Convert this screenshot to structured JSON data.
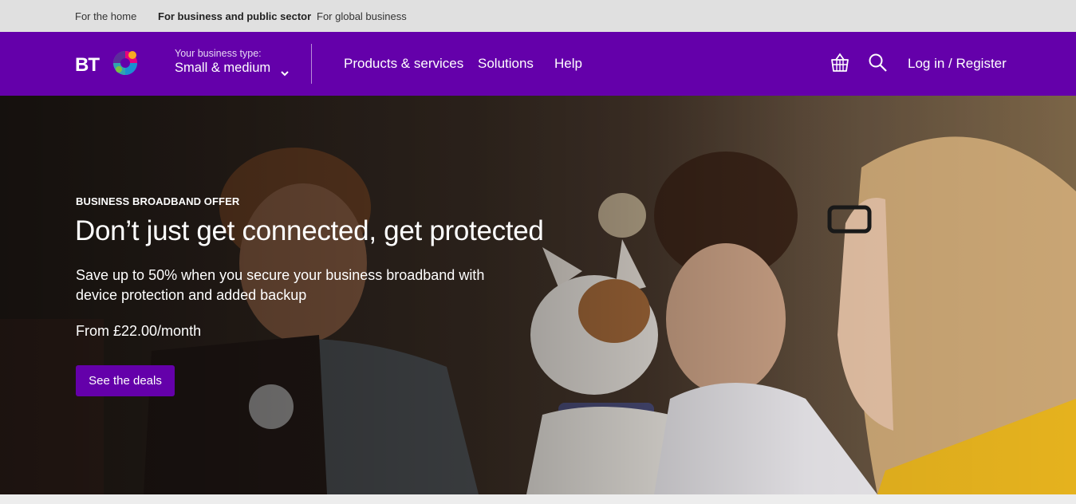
{
  "topbar": {
    "links": [
      "For the home",
      "For business and public sector",
      "For global business"
    ],
    "active_index": 1
  },
  "nav": {
    "logo_text": "BT",
    "business_type_label": "Your business type:",
    "business_type_value": "Small & medium",
    "links": [
      "Products & services",
      "Solutions",
      "Help"
    ],
    "basket_icon": "basket-icon",
    "search_icon": "search-icon",
    "login_label": "Log in / Register"
  },
  "hero": {
    "eyebrow": "BUSINESS BROADBAND OFFER",
    "headline": "Don’t just get connected, get protected",
    "subtext": "Save up to 50% when you secure your business broadband with device protection and added backup",
    "price": "From £22.00/month",
    "cta_label": "See the deals"
  },
  "colors": {
    "brand_purple": "#6400aa",
    "topbar_bg": "#e0e0e0"
  }
}
